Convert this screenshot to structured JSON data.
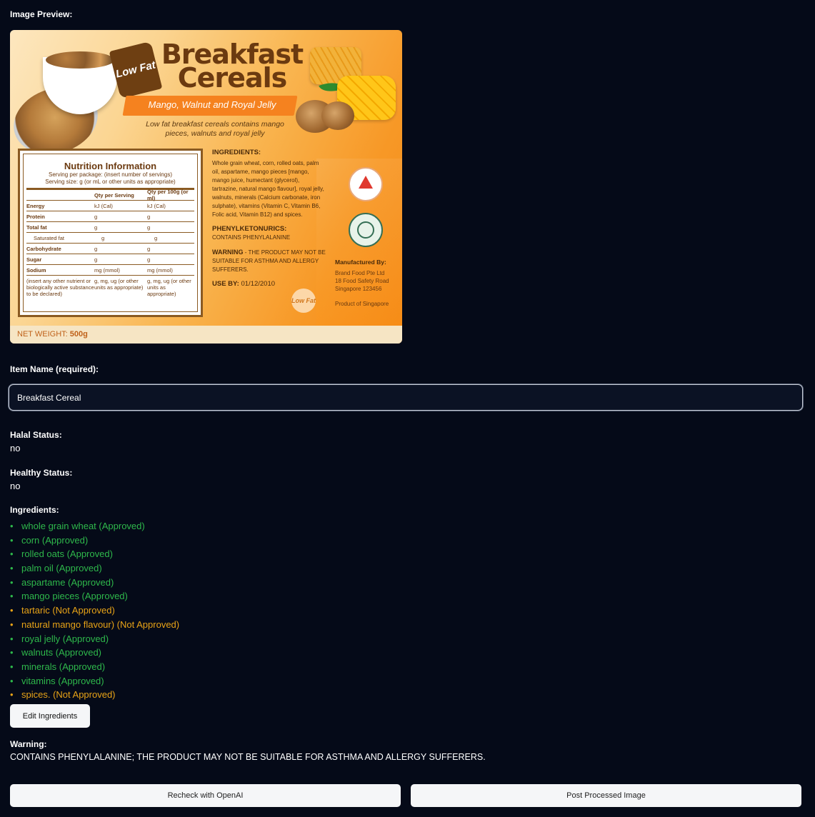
{
  "preview": {
    "label": "Image Preview:",
    "product_label": {
      "badge": "Low Fat",
      "title_line1": "Breakfast",
      "title_line2": "Cereals",
      "subtitle": "Mango, Walnut and Royal Jelly",
      "tagline": "Low fat breakfast cereals contains mango pieces, walnuts and royal jelly",
      "nutrition": {
        "title": "Nutrition Information",
        "serving_per_package": "Serving per package: (insert number of servings)",
        "serving_size": "Serving size: g (or mL or other units as appropriate)",
        "columns": [
          "",
          "Qty per Serving",
          "Qty per 100g (or ml)"
        ],
        "rows": [
          {
            "name": "Energy",
            "per_serving": "kJ (Cal)",
            "per_100g": "kJ (Cal)"
          },
          {
            "name": "Protein",
            "per_serving": "g",
            "per_100g": "g"
          },
          {
            "name": "Total fat",
            "per_serving": "g",
            "per_100g": "g"
          },
          {
            "name": "Saturated fat",
            "per_serving": "g",
            "per_100g": "g"
          },
          {
            "name": "Carbohydrate",
            "per_serving": "g",
            "per_100g": "g"
          },
          {
            "name": "Sugar",
            "per_serving": "g",
            "per_100g": "g"
          },
          {
            "name": "Sodium",
            "per_serving": "mg (mmol)",
            "per_100g": "mg (mmol)"
          }
        ],
        "footnote": {
          "name": "(insert any other nutrient or biologically active substance to be declared)",
          "per_serving": "g, mg, ug (or other units as appropriate)",
          "per_100g": "g, mg, ug (or other units as appropriate)"
        }
      },
      "ingredients_heading": "INGREDIENTS:",
      "ingredients_text": "Whole grain wheat, corn, rolled oats, palm oil, aspartame, mango pieces [mango, mango juice, humectant (glycerol), tartrazine, natural mango flavour], royal jelly, walnuts, minerals (Calcium carbonate, iron sulphate), vitamins (Vitamin C, Vitamin B6, Folic acid, Vitamin B12) and spices.",
      "pku_heading": "PHENYLKETONURICS:",
      "pku_text": "CONTAINS PHENYLALANINE",
      "warning_heading": "WARNING",
      "warning_text": " - THE PRODUCT MAY NOT BE SUITABLE FOR ASTHMA AND ALLERGY SUFFERERS.",
      "use_by_label": "USE BY:",
      "use_by_date": " 01/12/2010",
      "low_fat_circle": "Low Fat",
      "manufacturer_heading": "Manufactured By:",
      "manufacturer_lines": [
        "Brand Food Pte Ltd",
        "18 Food Safety Road",
        "Singapore 123456"
      ],
      "origin": "Product of Singapore",
      "net_weight_label": "NET WEIGHT: ",
      "net_weight_value": "500g"
    }
  },
  "item_name": {
    "label": "Item Name (required):",
    "value": "Breakfast Cereal"
  },
  "halal": {
    "label": "Halal Status:",
    "value": "no"
  },
  "healthy": {
    "label": "Healthy Status:",
    "value": "no"
  },
  "ingredients": {
    "label": "Ingredients:",
    "items": [
      {
        "text": "whole grain wheat (Approved)",
        "approved": true
      },
      {
        "text": "corn (Approved)",
        "approved": true
      },
      {
        "text": "rolled oats (Approved)",
        "approved": true
      },
      {
        "text": "palm oil (Approved)",
        "approved": true
      },
      {
        "text": "aspartame (Approved)",
        "approved": true
      },
      {
        "text": "mango pieces (Approved)",
        "approved": true
      },
      {
        "text": "tartaric (Not Approved)",
        "approved": false
      },
      {
        "text": "natural mango flavour) (Not Approved)",
        "approved": false
      },
      {
        "text": "royal jelly (Approved)",
        "approved": true
      },
      {
        "text": "walnuts (Approved)",
        "approved": true
      },
      {
        "text": "minerals (Approved)",
        "approved": true
      },
      {
        "text": "vitamins (Approved)",
        "approved": true
      },
      {
        "text": "spices. (Not Approved)",
        "approved": false
      }
    ],
    "edit_button": "Edit Ingredients"
  },
  "warning": {
    "label": "Warning:",
    "value": "CONTAINS PHENYLALANINE; THE PRODUCT MAY NOT BE SUITABLE FOR ASTHMA AND ALLERGY SUFFERERS."
  },
  "actions": {
    "recheck": "Recheck with OpenAI",
    "post": "Post Processed Image"
  },
  "colors": {
    "background": "#050a18",
    "approved": "#2eb84b",
    "not_approved": "#e8a317"
  }
}
